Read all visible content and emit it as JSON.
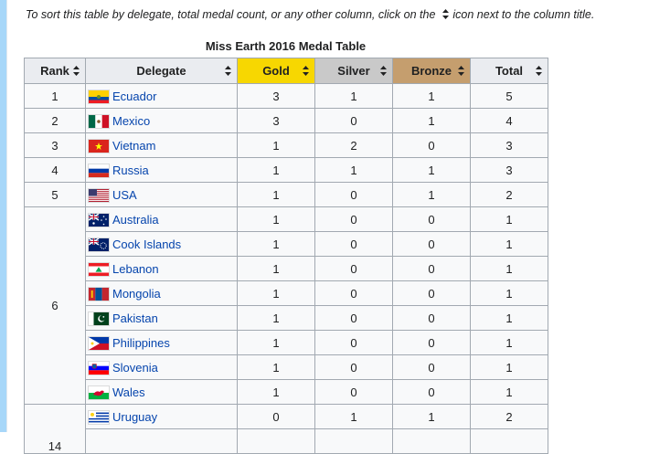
{
  "instructions": {
    "before": "To sort this table by delegate, total medal count, or any other column, click on the",
    "after": "icon next to the column title."
  },
  "table": {
    "caption": "Miss Earth 2016 Medal Table",
    "headers": {
      "rank": "Rank",
      "delegate": "Delegate",
      "gold": "Gold",
      "silver": "Silver",
      "bronze": "Bronze",
      "total": "Total"
    },
    "header_colors": {
      "gold": "#f7d701",
      "silver": "#c9c9c9",
      "bronze": "#c59e6e"
    },
    "rows": [
      {
        "rank": "1",
        "delegate": "Ecuador",
        "flag": "ecuador-flag-icon",
        "gold": "3",
        "silver": "1",
        "bronze": "1",
        "total": "5"
      },
      {
        "rank": "2",
        "delegate": "Mexico",
        "flag": "mexico-flag-icon",
        "gold": "3",
        "silver": "0",
        "bronze": "1",
        "total": "4"
      },
      {
        "rank": "3",
        "delegate": "Vietnam",
        "flag": "vietnam-flag-icon",
        "gold": "1",
        "silver": "2",
        "bronze": "0",
        "total": "3"
      },
      {
        "rank": "4",
        "delegate": "Russia",
        "flag": "russia-flag-icon",
        "gold": "1",
        "silver": "1",
        "bronze": "1",
        "total": "3"
      },
      {
        "rank": "5",
        "delegate": "USA",
        "flag": "usa-flag-icon",
        "gold": "1",
        "silver": "0",
        "bronze": "1",
        "total": "2"
      },
      {
        "rank": "6",
        "delegate": "Australia",
        "flag": "australia-flag-icon",
        "gold": "1",
        "silver": "0",
        "bronze": "0",
        "total": "1"
      },
      {
        "rank": "",
        "delegate": "Cook Islands",
        "flag": "cook-islands-flag-icon",
        "gold": "1",
        "silver": "0",
        "bronze": "0",
        "total": "1"
      },
      {
        "rank": "",
        "delegate": "Lebanon",
        "flag": "lebanon-flag-icon",
        "gold": "1",
        "silver": "0",
        "bronze": "0",
        "total": "1"
      },
      {
        "rank": "",
        "delegate": "Mongolia",
        "flag": "mongolia-flag-icon",
        "gold": "1",
        "silver": "0",
        "bronze": "0",
        "total": "1"
      },
      {
        "rank": "",
        "delegate": "Pakistan",
        "flag": "pakistan-flag-icon",
        "gold": "1",
        "silver": "0",
        "bronze": "0",
        "total": "1"
      },
      {
        "rank": "",
        "delegate": "Philippines",
        "flag": "philippines-flag-icon",
        "gold": "1",
        "silver": "0",
        "bronze": "0",
        "total": "1"
      },
      {
        "rank": "",
        "delegate": "Slovenia",
        "flag": "slovenia-flag-icon",
        "gold": "1",
        "silver": "0",
        "bronze": "0",
        "total": "1"
      },
      {
        "rank": "",
        "delegate": "Wales",
        "flag": "wales-flag-icon",
        "gold": "1",
        "silver": "0",
        "bronze": "0",
        "total": "1"
      },
      {
        "rank": "14",
        "delegate": "Uruguay",
        "flag": "uruguay-flag-icon",
        "gold": "0",
        "silver": "1",
        "bronze": "1",
        "total": "2"
      }
    ]
  },
  "colors": {
    "link": "#0645ad",
    "border": "#a2a9b1",
    "header_bg": "#eaecf0",
    "cell_bg": "#f8f9fa"
  }
}
